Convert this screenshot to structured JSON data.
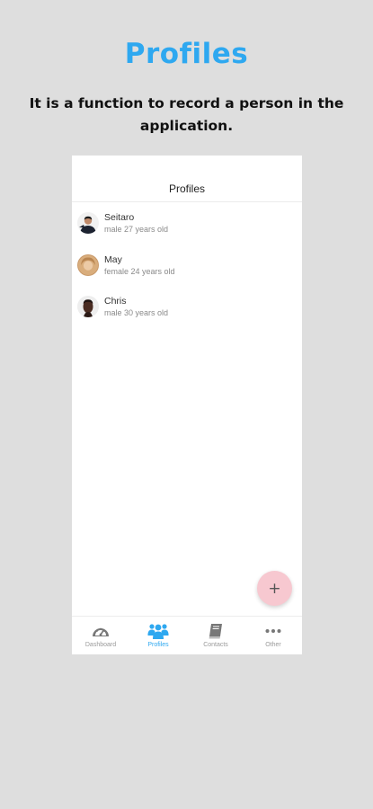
{
  "promo": {
    "title": "Profiles",
    "subtitle": "It is a function to record a person in the application."
  },
  "app": {
    "header_title": "Profiles",
    "profiles": [
      {
        "name": "Seitaro",
        "detail": "male 27 years old",
        "avatar_icon": "avatar-seitaro"
      },
      {
        "name": "May",
        "detail": "female 24 years old",
        "avatar_icon": "avatar-may"
      },
      {
        "name": "Chris",
        "detail": "male 30 years old",
        "avatar_icon": "avatar-chris"
      }
    ],
    "fab_label": "+",
    "tabs": [
      {
        "label": "Dashboard",
        "icon": "speedometer-icon",
        "active": false
      },
      {
        "label": "Profiles",
        "icon": "users-icon",
        "active": true
      },
      {
        "label": "Contacts",
        "icon": "book-icon",
        "active": false
      },
      {
        "label": "Other",
        "icon": "more-dots-icon",
        "active": false
      }
    ]
  },
  "colors": {
    "background": "#dedede",
    "accent": "#2ea8f0",
    "fab": "#f7c8d0",
    "inactive_tab": "#9a9a9a"
  }
}
